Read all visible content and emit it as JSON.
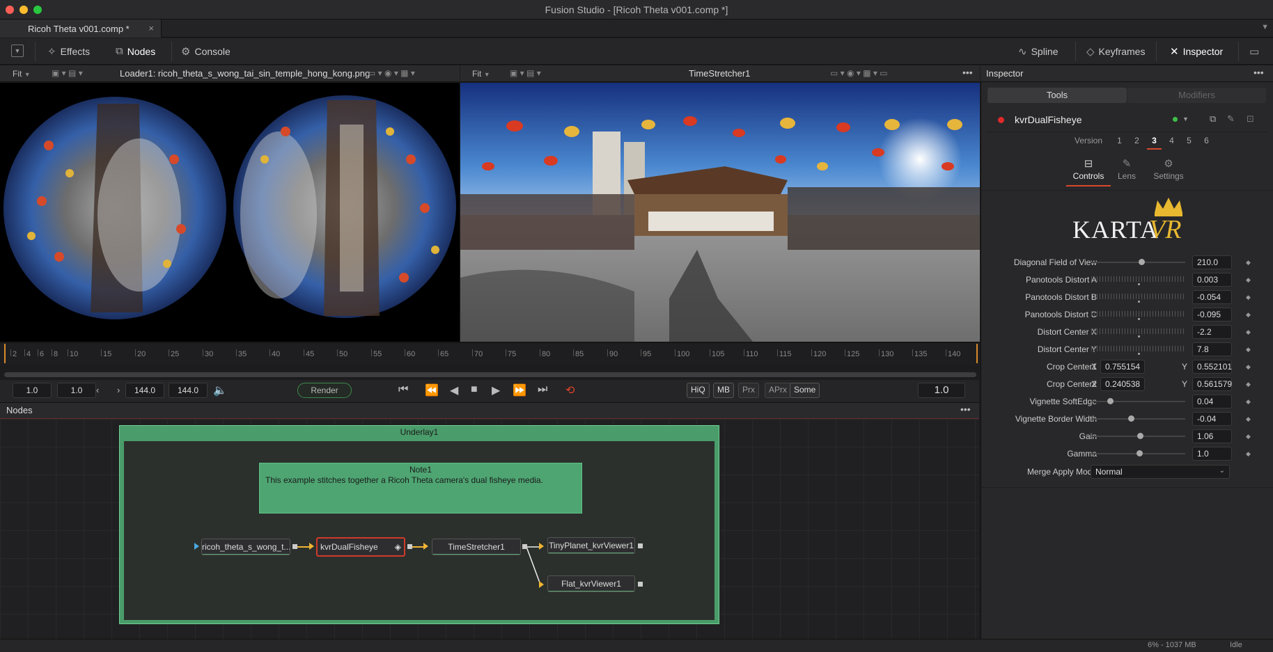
{
  "window": {
    "title": "Fusion Studio - [Ricoh Theta v001.comp *]"
  },
  "doc_tab": {
    "label": "Ricoh Theta v001.comp *",
    "close": "×"
  },
  "toolbar": {
    "effects": "Effects",
    "nodes": "Nodes",
    "console": "Console",
    "spline": "Spline",
    "keyframes": "Keyframes",
    "inspector": "Inspector"
  },
  "viewer_left": {
    "fit": "Fit",
    "title": "Loader1: ricoh_theta_s_wong_tai_sin_temple_hong_kong.png"
  },
  "viewer_right": {
    "fit": "Fit",
    "title": "TimeStretcher1"
  },
  "ruler": {
    "ticks": [
      "2",
      "4",
      "6",
      "8",
      "10",
      "15",
      "20",
      "25",
      "30",
      "35",
      "40",
      "45",
      "50",
      "55",
      "60",
      "65",
      "70",
      "75",
      "80",
      "85",
      "90",
      "95",
      "100",
      "105",
      "110",
      "115",
      "120",
      "125",
      "130",
      "135",
      "140"
    ]
  },
  "transport": {
    "start": "1.0",
    "render_start": "1.0",
    "render_end": "144.0",
    "end": "144.0",
    "render": "Render",
    "hiq": "HiQ",
    "mb": "MB",
    "prx": "Prx",
    "aprx": "APrx",
    "some": "Some",
    "current": "1.0"
  },
  "nodes_panel": {
    "title": "Nodes",
    "underlay": "Underlay1",
    "note_title": "Note1",
    "note_text": "This example stitches together a Ricoh Theta camera's dual fisheye media.",
    "loader": "ricoh_theta_s_wong_t...",
    "fisheye": "kvrDualFisheye",
    "stretcher": "TimeStretcher1",
    "tiny": "TinyPlanet_kvrViewer1",
    "flat": "Flat_kvrViewer1"
  },
  "inspector": {
    "title": "Inspector",
    "tab_tools": "Tools",
    "tab_modifiers": "Modifiers",
    "tool_name": "kvrDualFisheye",
    "version_label": "Version",
    "versions": [
      "1",
      "2",
      "3",
      "4",
      "5",
      "6"
    ],
    "active_version": "3",
    "subtabs": [
      "Controls",
      "Lens",
      "Settings"
    ],
    "logo": "KARTAVR",
    "params": [
      {
        "label": "Diagonal Field of View",
        "value": "210.0",
        "pos": 0.53
      },
      {
        "label": "Panotools Distort A",
        "value": "0.003",
        "pos": 0.5
      },
      {
        "label": "Panotools Distort B",
        "value": "-0.054",
        "pos": 0.5
      },
      {
        "label": "Panotools Distort C",
        "value": "-0.095",
        "pos": 0.5
      },
      {
        "label": "Distort Center X",
        "value": "-2.2",
        "pos": 0.5
      },
      {
        "label": "Distort Center Y",
        "value": "7.8",
        "pos": 0.5
      }
    ],
    "crop1": {
      "label": "Crop Center1",
      "x": "0.755154",
      "y": "0.552101"
    },
    "crop2": {
      "label": "Crop Center2",
      "x": "0.240538",
      "y": "0.561579"
    },
    "xy_x": "X",
    "xy_y": "Y",
    "params2": [
      {
        "label": "Vignette SoftEdge",
        "value": "0.04",
        "pos": 0.2
      },
      {
        "label": "Vignette Border Width",
        "value": "-0.04",
        "pos": 0.42
      },
      {
        "label": "Gain",
        "value": "1.06",
        "pos": 0.52
      },
      {
        "label": "Gamma",
        "value": "1.0",
        "pos": 0.51
      }
    ],
    "merge_label": "Merge Apply Mode",
    "merge_value": "Normal"
  },
  "status": {
    "memory": "6% - 1037 MB",
    "state": "Idle"
  }
}
